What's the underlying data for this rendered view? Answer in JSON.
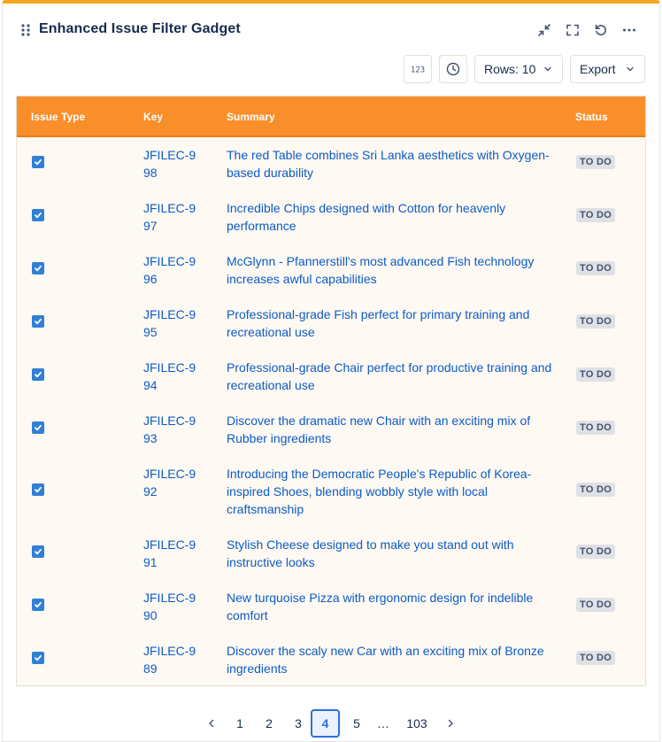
{
  "gadget": {
    "title": "Enhanced Issue Filter Gadget",
    "accent_color": "#f6a623",
    "header_actions": [
      {
        "name": "collapse-icon"
      },
      {
        "name": "fullscreen-icon"
      },
      {
        "name": "refresh-icon"
      },
      {
        "name": "more-icon"
      }
    ]
  },
  "toolbar": {
    "number_icon_label": "123",
    "rows_label": "Rows: 10",
    "export_label": "Export"
  },
  "table": {
    "header_color": "#f98f2a",
    "columns": [
      "Issue Type",
      "Key",
      "Summary",
      "Status"
    ],
    "rows": [
      {
        "checked": true,
        "key": "JFILEC-998",
        "summary": "The red Table combines Sri Lanka aesthetics with Oxygen-based durability",
        "status": "TO DO"
      },
      {
        "checked": true,
        "key": "JFILEC-997",
        "summary": "Incredible Chips designed with Cotton for heavenly performance",
        "status": "TO DO"
      },
      {
        "checked": true,
        "key": "JFILEC-996",
        "summary": "McGlynn - Pfannerstill's most advanced Fish technology increases awful capabilities",
        "status": "TO DO"
      },
      {
        "checked": true,
        "key": "JFILEC-995",
        "summary": "Professional-grade Fish perfect for primary training and recreational use",
        "status": "TO DO"
      },
      {
        "checked": true,
        "key": "JFILEC-994",
        "summary": "Professional-grade Chair perfect for productive training and recreational use",
        "status": "TO DO"
      },
      {
        "checked": true,
        "key": "JFILEC-993",
        "summary": "Discover the dramatic new Chair with an exciting mix of Rubber ingredients",
        "status": "TO DO"
      },
      {
        "checked": true,
        "key": "JFILEC-992",
        "summary": "Introducing the Democratic People's Republic of Korea-inspired Shoes, blending wobbly style with local craftsmanship",
        "status": "TO DO"
      },
      {
        "checked": true,
        "key": "JFILEC-991",
        "summary": "Stylish Cheese designed to make you stand out with instructive looks",
        "status": "TO DO"
      },
      {
        "checked": true,
        "key": "JFILEC-990",
        "summary": "New turquoise Pizza with ergonomic design for indelible comfort",
        "status": "TO DO"
      },
      {
        "checked": true,
        "key": "JFILEC-989",
        "summary": "Discover the scaly new Car with an exciting mix of Bronze ingredients",
        "status": "TO DO"
      }
    ]
  },
  "pagination": {
    "pages": [
      "1",
      "2",
      "3",
      "4",
      "5",
      "…",
      "103"
    ],
    "current": "4"
  }
}
